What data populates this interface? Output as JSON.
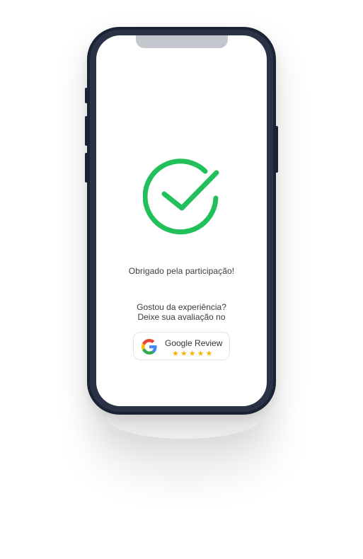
{
  "screen": {
    "thanks_text": "Obrigado pela participação!",
    "prompt_line1": "Gostou da experiência?",
    "prompt_line2": "Deixe sua avaliação no"
  },
  "review_button": {
    "label": "Google Review",
    "stars": "★★★★★",
    "rating": 5
  },
  "colors": {
    "success_green": "#22c05a",
    "phone_frame": "#1b2233",
    "notch": "#c4c7cd",
    "star": "#f5b400"
  },
  "icons": {
    "success": "check-circle-icon",
    "brand": "google-logo-icon"
  }
}
